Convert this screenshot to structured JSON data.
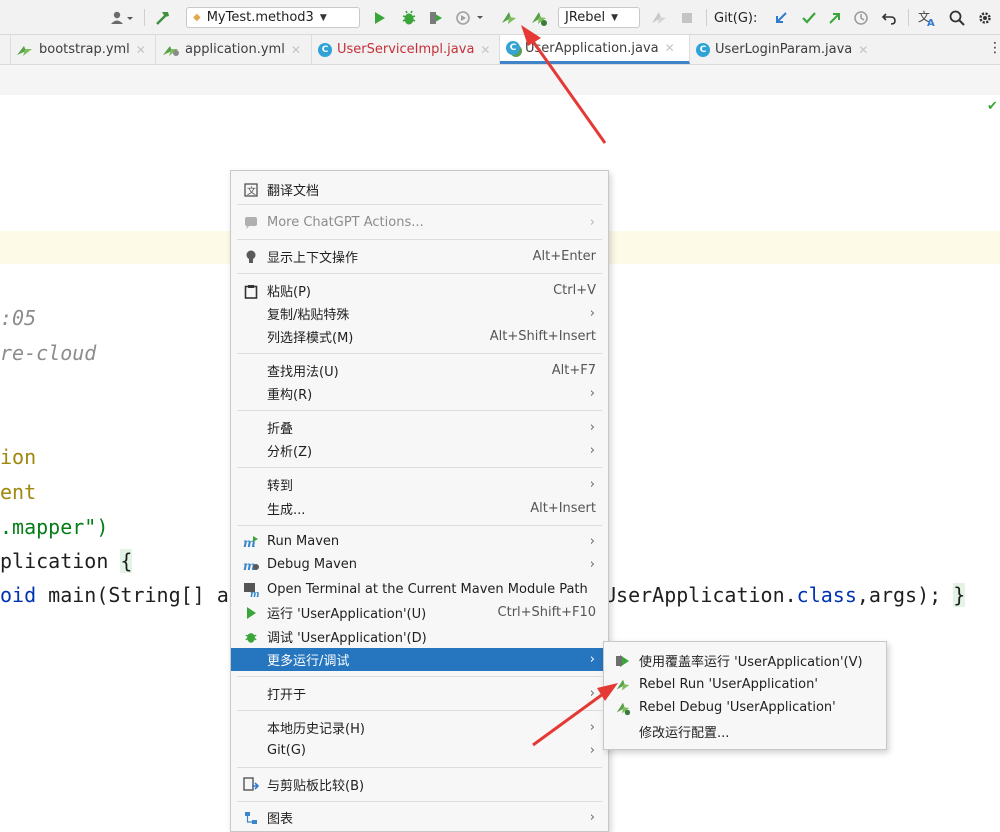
{
  "toolbar": {
    "run_config": "MyTest.method3",
    "jrebel_combo": "JRebel",
    "git_label": "Git(G):"
  },
  "tabs": [
    {
      "label": "bootstrap.yml"
    },
    {
      "label": "application.yml"
    },
    {
      "label": "UserServiceImpl.java"
    },
    {
      "label": "UserApplication.java"
    },
    {
      "label": "UserLoginParam.java"
    }
  ],
  "code": {
    "line1": ":05",
    "line2": "re-cloud",
    "line3": "ion",
    "line4": "ent",
    "line5": ".mapper\")",
    "line6a": "plication ",
    "line6b": "{",
    "line7a": "oid ",
    "line7b": "main(String[] a",
    "line7c": "UserApplication.",
    "line7d": "class",
    "line7e": ",args); ",
    "line7f": "}"
  },
  "menu": {
    "translate_doc": "翻译文档",
    "chatgpt": "More ChatGPT Actions...",
    "context_actions": "显示上下文操作",
    "context_actions_sc": "Alt+Enter",
    "paste": "粘贴(P)",
    "paste_sc": "Ctrl+V",
    "copy_paste_special": "复制/粘贴特殊",
    "column_mode": "列选择模式(M)",
    "column_mode_sc": "Alt+Shift+Insert",
    "find_usages": "查找用法(U)",
    "find_usages_sc": "Alt+F7",
    "refactor": "重构(R)",
    "folding": "折叠",
    "analyze": "分析(Z)",
    "goto": "转到",
    "generate": "生成...",
    "generate_sc": "Alt+Insert",
    "run_maven": "Run Maven",
    "debug_maven": "Debug Maven",
    "open_terminal": "Open Terminal at the Current Maven Module Path",
    "run_app": "运行 'UserApplication'(U)",
    "run_app_sc": "Ctrl+Shift+F10",
    "debug_app": "调试 'UserApplication'(D)",
    "more_run_debug": "更多运行/调试",
    "open_in": "打开于",
    "local_history": "本地历史记录(H)",
    "git": "Git(G)",
    "compare_clipboard": "与剪贴板比较(B)",
    "diagrams": "图表"
  },
  "submenu": {
    "run_coverage": "使用覆盖率运行 'UserApplication'(V)",
    "rebel_run": "Rebel Run 'UserApplication'",
    "rebel_debug": "Rebel Debug 'UserApplication'",
    "modify_config": "修改运行配置..."
  },
  "colors": {
    "selection": "#2675bf",
    "annotation_arrow": "#e53935"
  }
}
